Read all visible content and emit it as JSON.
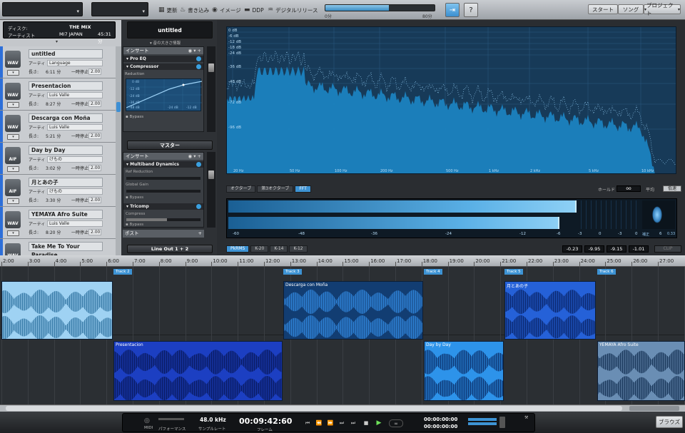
{
  "toolbar": {
    "update": "更新",
    "write": "書き込み",
    "image": "イメージ",
    "ddp": "DDP",
    "digital_release": "デジタルリリース",
    "progress_start": "0分",
    "progress_end": "80分",
    "progress_fraction": 0.58,
    "help": "?",
    "start": "スタート",
    "song": "ソング",
    "project": "プロジェクト"
  },
  "disc": {
    "disc_label": "ディスク:",
    "disc_title": "THE MIX",
    "artist_label": "アーティスト",
    "artist": "MI7 JAPAN",
    "duration": "45:31 分"
  },
  "tracks": [
    {
      "num": "1",
      "format": "WAV",
      "title": "untitled",
      "artist_label": "アーティ",
      "artist": "Language",
      "length_label": "長さ:",
      "length": "6:11 分",
      "pause_label": "一時停止",
      "pause": "2.00"
    },
    {
      "num": "2",
      "format": "WAV",
      "title": "Presentacion",
      "artist_label": "アーティ",
      "artist": "Luis Valle",
      "length_label": "長さ:",
      "length": "8:27 分",
      "pause_label": "一時停止",
      "pause": "2.00"
    },
    {
      "num": "3",
      "format": "WAV",
      "title": "Descarga con Moña",
      "artist_label": "アーティ",
      "artist": "Luis Valle",
      "length_label": "長さ:",
      "length": "5:21 分",
      "pause_label": "一時停止",
      "pause": "2.00"
    },
    {
      "num": "4",
      "format": "AIF",
      "title": "Day by Day",
      "artist_label": "アーティ",
      "artist": "けもの",
      "length_label": "長さ:",
      "length": "3:02 分",
      "pause_label": "一時停止",
      "pause": "2.00"
    },
    {
      "num": "5",
      "format": "AIF",
      "title": "月とあの子",
      "artist_label": "アーティ",
      "artist": "けもの",
      "length_label": "長さ:",
      "length": "3:30 分",
      "pause_label": "一時停止",
      "pause": "2.00"
    },
    {
      "num": "6",
      "format": "WAV",
      "title": "YEMAYA Afro Suite",
      "artist_label": "アーティ",
      "artist": "Luis Valle",
      "length_label": "長さ:",
      "length": "8:20 分",
      "pause_label": "一時停止",
      "pause": "2.00"
    },
    {
      "num": "7",
      "format": "WAV",
      "title": "Take Me To Your Paradise",
      "artist_label": "",
      "artist": "",
      "length_label": "",
      "length": "",
      "pause_label": "",
      "pause": ""
    }
  ],
  "inserts": {
    "song_name": "untitled",
    "size_info": "音の大きさ情報",
    "insert_label": "インサート",
    "pro_eq": "Pro EQ",
    "compressor": "Compressor",
    "reduction": "Reduction",
    "comp_scale": [
      "0 dB",
      "-12 dB",
      "-24 dB",
      "-36 dB",
      "-48 dB",
      "-24 dB",
      "-12 dB"
    ],
    "bypass": "Bypass",
    "master": "マスター",
    "insert_label2": "インサート",
    "multiband": "Multiband Dynamics",
    "ref_reduction": "Ref Reduction",
    "global_gain": "Global Gain",
    "bypass2": "Bypass",
    "tricomp": "Tricomp",
    "compress": "Compress",
    "bypass3": "Bypass",
    "post": "ポスト",
    "output": "Line Out 1 + 2"
  },
  "fft": {
    "db_labels": [
      "0 dB",
      "-6 dB",
      "-12 dB",
      "-18 dB",
      "-24 dB",
      "-36 dB",
      "-48 dB",
      "-72 dB",
      "-96 dB"
    ],
    "freq_labels": [
      "20 Hz",
      "50 Hz",
      "100 Hz",
      "200 Hz",
      "500 Hz",
      "1 kHz",
      "2 kHz",
      "5 kHz",
      "10 kHz"
    ],
    "tab_octave": "オクターブ",
    "tab_third": "第3オクターブ",
    "tab_fft": "FFT",
    "hold_label": "ホールド",
    "hold_value": "oo",
    "avg_label": "平均",
    "avg_value": "低速"
  },
  "meter": {
    "scale": [
      "-60",
      "-48",
      "-36",
      "-24",
      "-12",
      "-6",
      "-3",
      "0",
      "-3",
      "0",
      "6"
    ],
    "corr_label": "補正",
    "corr_value": "0.33",
    "modes": [
      "PkRMS",
      "K-20",
      "K-14",
      "K-12"
    ],
    "values": [
      "-0.23",
      "-9.95",
      "-9.15",
      "-1.01"
    ],
    "clip": "CLIP"
  },
  "timeline": {
    "ticks": [
      "2:00",
      "3:00",
      "4:00",
      "5:00",
      "6:00",
      "7:00",
      "8:00",
      "9:00",
      "10:00",
      "11:00",
      "12:00",
      "13:00",
      "14:00",
      "15:00",
      "16:00",
      "17:00",
      "18:00",
      "19:00",
      "20:00",
      "21:00",
      "22:00",
      "23:00",
      "24:00",
      "25:00",
      "26:00",
      "27:00"
    ],
    "markers": [
      "Track 2",
      "Track 3",
      "Track 4",
      "Track 5",
      "Track 6"
    ]
  },
  "clips": {
    "c3": "Descarga con Moña",
    "c5": "月とあの子",
    "c2": "Presentacion",
    "c4": "Day by Day",
    "c6": "YEMAYA Afro Suite"
  },
  "transport": {
    "midi": "MIDI",
    "performance": "パフォーマンス",
    "sample_rate": "48.0 kHz",
    "sample_rate_label": "サンプルレート",
    "time": "00:09:42:60",
    "frame_label": "フレーム",
    "loop_start": "00:00:00:00",
    "loop_end": "00:00:00:00",
    "browse": "ブラウズ"
  }
}
